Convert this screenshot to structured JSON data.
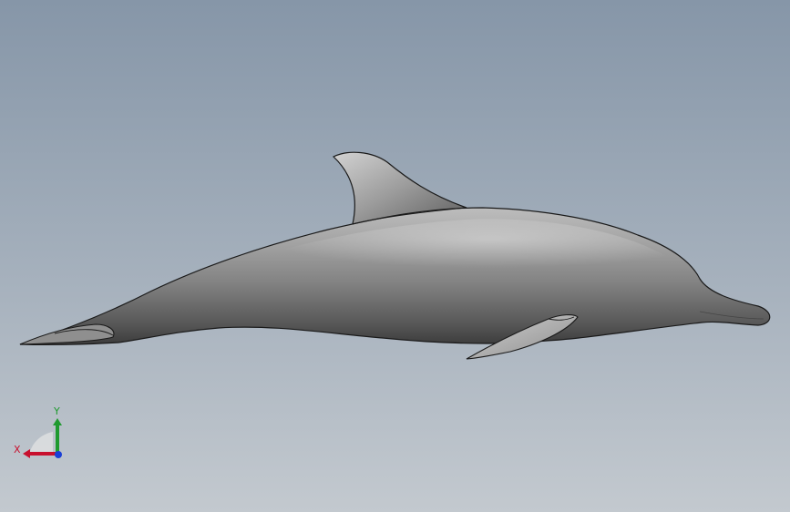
{
  "viewport": {
    "background_top": "#8696a8",
    "background_bottom": "#c3c9cf"
  },
  "model": {
    "body_color": "#8a8a8a",
    "edge_color": "#1a1a1a"
  },
  "triad": {
    "x_label": "X",
    "y_label": "Y",
    "x_color": "#c8102e",
    "y_color": "#1f9a2f",
    "z_color": "#1a3fd6"
  }
}
